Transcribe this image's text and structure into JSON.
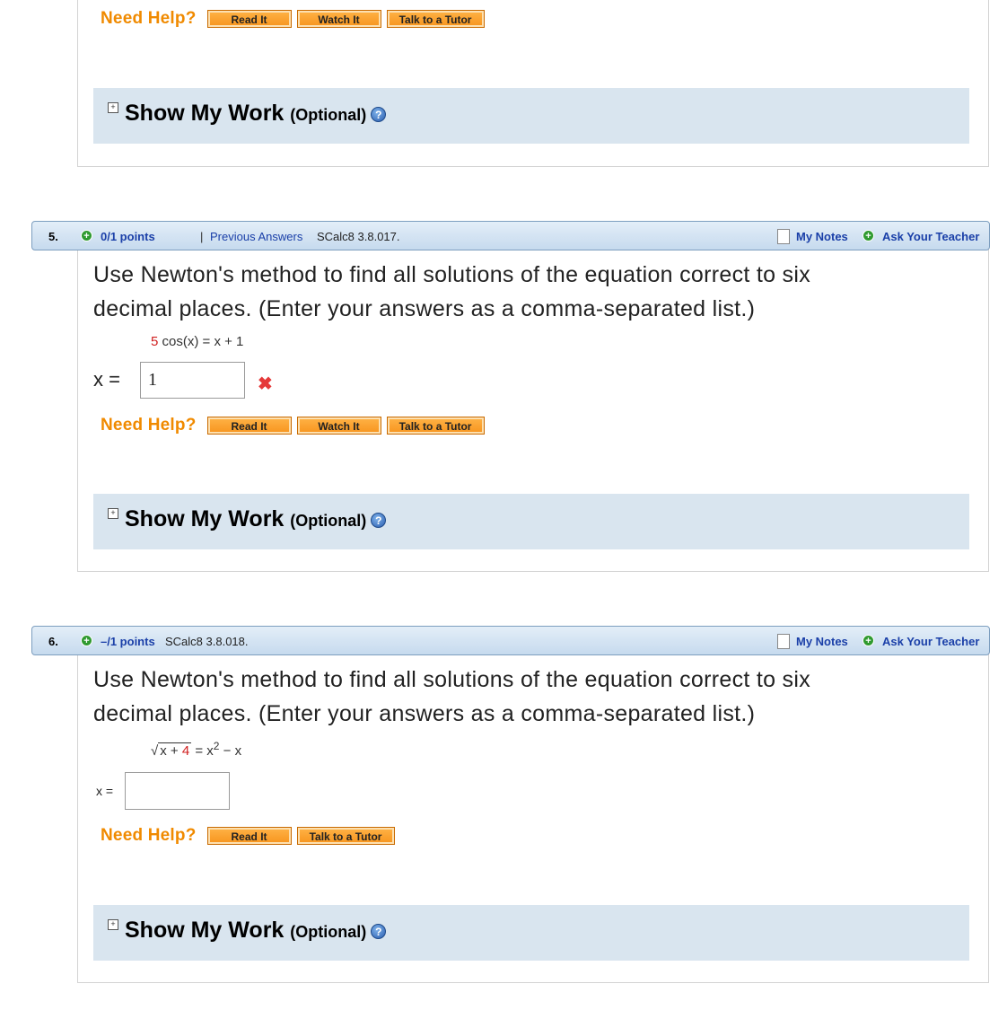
{
  "need_help_label": "Need Help?",
  "buttons": {
    "read_it": "Read It",
    "watch_it": "Watch It",
    "talk_to_tutor": "Talk to a Tutor"
  },
  "show_my_work": {
    "plus_glyph": "+",
    "title": "Show My Work",
    "optional": "(Optional)",
    "help_glyph": "?"
  },
  "q5": {
    "number": "5.",
    "points": "0/1 points",
    "separator": "|",
    "previous_answers": "Previous Answers",
    "code": "SCalc8 3.8.017.",
    "my_notes": "My Notes",
    "ask_teacher": "Ask Your Teacher",
    "text_line1": "Use Newton's method to find all solutions of the equation correct to six",
    "text_line2": "decimal places. (Enter your answers as a comma-separated list.)",
    "eq_coef": "5",
    "eq_rest": " cos(x) = x + 1",
    "answer_label": "x =",
    "answer_value": "1",
    "incorrect_mark": "✖"
  },
  "q6": {
    "number": "6.",
    "points": "–/1 points",
    "code": "SCalc8 3.8.018.",
    "my_notes": "My Notes",
    "ask_teacher": "Ask Your Teacher",
    "text_line1": "Use Newton's method to find all solutions of the equation correct to six",
    "text_line2": "decimal places. (Enter your answers as a comma-separated list.)",
    "eq_radical_sign": "√",
    "eq_radicand_x": "x + ",
    "eq_radicand_num": "4",
    "eq_rhs_prefix": " = x",
    "eq_exponent": "2",
    "eq_rhs_suffix": " − x",
    "answer_label": "x =",
    "answer_value": ""
  },
  "icons": {
    "plus": "+",
    "notes": "notes-icon",
    "help": "help-icon"
  }
}
